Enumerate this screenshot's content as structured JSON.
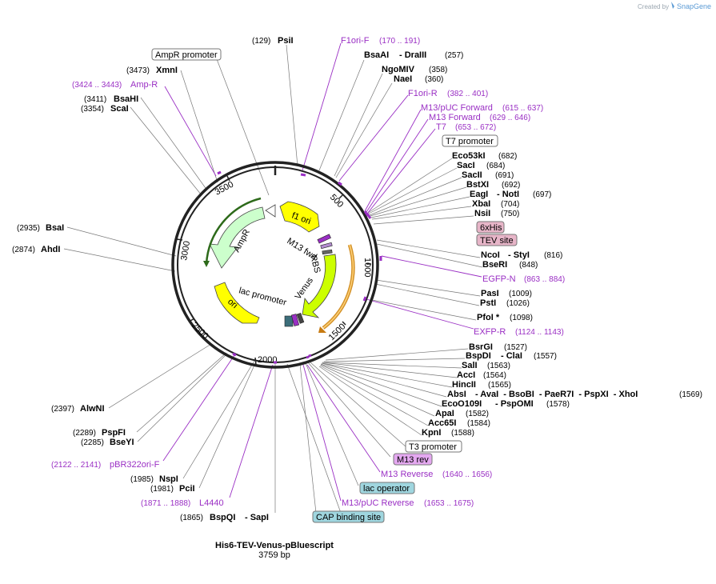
{
  "credit": {
    "prefix": "Created by",
    "brand": "SnapGene"
  },
  "map": {
    "name": "His6-TEV-Venus-pBluescript",
    "length_label": "3759 bp"
  },
  "ticks": [
    "500",
    "1000",
    "1500",
    "2000",
    "2500",
    "3000",
    "3500"
  ],
  "enzymes": {
    "psiI": {
      "name": "PsiI",
      "pos": "(129)"
    },
    "bsaAI": {
      "name": "BsaAI",
      "sep": "- DraIII",
      "pos": "(257)"
    },
    "ngoMIV": {
      "name": "NgoMIV",
      "pos": "(358)"
    },
    "naeI": {
      "name": "NaeI",
      "pos": "(360)"
    },
    "eco53kI": {
      "name": "Eco53kI",
      "pos": "(682)"
    },
    "sacI": {
      "name": "SacI",
      "pos": "(684)"
    },
    "sacII": {
      "name": "SacII",
      "pos": "(691)"
    },
    "bstXI": {
      "name": "BstXI",
      "pos": "(692)"
    },
    "eagI": {
      "name": "EagI",
      "sep": "- NotI",
      "pos": "(697)"
    },
    "xbaI": {
      "name": "XbaI",
      "pos": "(704)"
    },
    "nsiI": {
      "name": "NsiI",
      "pos": "(750)"
    },
    "ncoI": {
      "name": "NcoI",
      "sep": "- StyI",
      "pos": "(816)"
    },
    "bseRI": {
      "name": "BseRI",
      "pos": "(848)"
    },
    "pasI": {
      "name": "PasI",
      "pos": "(1009)"
    },
    "pstI": {
      "name": "PstI",
      "pos": "(1026)"
    },
    "pfoI": {
      "name": "PfoI *",
      "pos": "(1098)"
    },
    "bsrGI": {
      "name": "BsrGI",
      "pos": "(1527)"
    },
    "bspDI": {
      "name": "BspDI",
      "sep": "- ClaI",
      "pos": "(1557)"
    },
    "salI": {
      "name": "SalI",
      "pos": "(1563)"
    },
    "accI": {
      "name": "AccI",
      "pos": "(1564)"
    },
    "hincII": {
      "name": "HincII",
      "pos": "(1565)"
    },
    "absI": {
      "name": "AbsI",
      "rest": "- AvaI  - BsoBI  - PaeR7I  - PspXI  - XhoI",
      "pos": "(1569)"
    },
    "ecoO109I": {
      "name": "EcoO109I",
      "sep": "- PspOMI",
      "pos": "(1578)"
    },
    "apaI": {
      "name": "ApaI",
      "pos": "(1582)"
    },
    "acc65I": {
      "name": "Acc65I",
      "pos": "(1584)"
    },
    "kpnI": {
      "name": "KpnI",
      "pos": "(1588)"
    },
    "bspQI": {
      "name": "BspQI",
      "sep": "- SapI",
      "pos": "(1865)"
    },
    "pciI": {
      "name": "PciI",
      "pos": "(1981)"
    },
    "nspI": {
      "name": "NspI",
      "pos": "(1985)"
    },
    "bseYI": {
      "name": "BseYI",
      "pos": "(2285)"
    },
    "pspFI": {
      "name": "PspFI",
      "pos": "(2289)"
    },
    "alwNI": {
      "name": "AlwNI",
      "pos": "(2397)"
    },
    "ahdI": {
      "name": "AhdI",
      "pos": "(2874)"
    },
    "bsaI": {
      "name": "BsaI",
      "pos": "(2935)"
    },
    "scaI": {
      "name": "ScaI",
      "pos": "(3354)"
    },
    "bsaHI": {
      "name": "BsaHI",
      "pos": "(3411)"
    },
    "xmnI": {
      "name": "XmnI",
      "pos": "(3473)"
    }
  },
  "primers": {
    "f1oriF": {
      "name": "F1ori-F",
      "range": "(170 .. 191)"
    },
    "f1oriR": {
      "name": "F1ori-R",
      "range": "(382 .. 401)"
    },
    "m13pucFwd": {
      "name": "M13/pUC Forward",
      "range": "(615 .. 637)"
    },
    "m13Fwd": {
      "name": "M13 Forward",
      "range": "(629 .. 646)"
    },
    "t7": {
      "name": "T7",
      "range": "(653 .. 672)"
    },
    "egfpN": {
      "name": "EGFP-N",
      "range": "(863 .. 884)"
    },
    "exfpR": {
      "name": "EXFP-R",
      "range": "(1124 .. 1143)"
    },
    "m13Rev": {
      "name": "M13 Reverse",
      "range": "(1640 .. 1656)"
    },
    "m13pucRev": {
      "name": "M13/pUC Reverse",
      "range": "(1653 .. 1675)"
    },
    "l4440": {
      "name": "L4440",
      "range": "(1871 .. 1888)"
    },
    "pbr322": {
      "name": "pBR322ori-F",
      "range": "(2122 .. 2141)"
    },
    "ampR": {
      "name": "Amp-R",
      "range": "(3424 .. 3443)"
    }
  },
  "boxes": {
    "ampRPromoter": "AmpR promoter",
    "t7Promoter": "T7 promoter",
    "his6": "6xHis",
    "tevSite": "TEV site",
    "t3Promoter": "T3 promoter",
    "m13rev": "M13 rev",
    "lacOperator": "lac operator",
    "cap": "CAP binding site"
  },
  "features": {
    "f1ori": "f1 ori",
    "ampR": "AmpR",
    "m13fwd": "M13 fwd",
    "rbs": "RBS",
    "venus": "Venus",
    "lacPromoter": "lac promoter",
    "ori": "ori"
  },
  "colors": {
    "feature_text": "#9a2fc4",
    "f1ori_fill": "#ffff00",
    "ampR_fill": "#ccffcc",
    "venus_fill": "#ccff00",
    "ori_fill": "#ffff00",
    "pink_box": "#e7b5c8",
    "blue_box": "#9fd6df",
    "violet_box": "#e4a8f0"
  }
}
